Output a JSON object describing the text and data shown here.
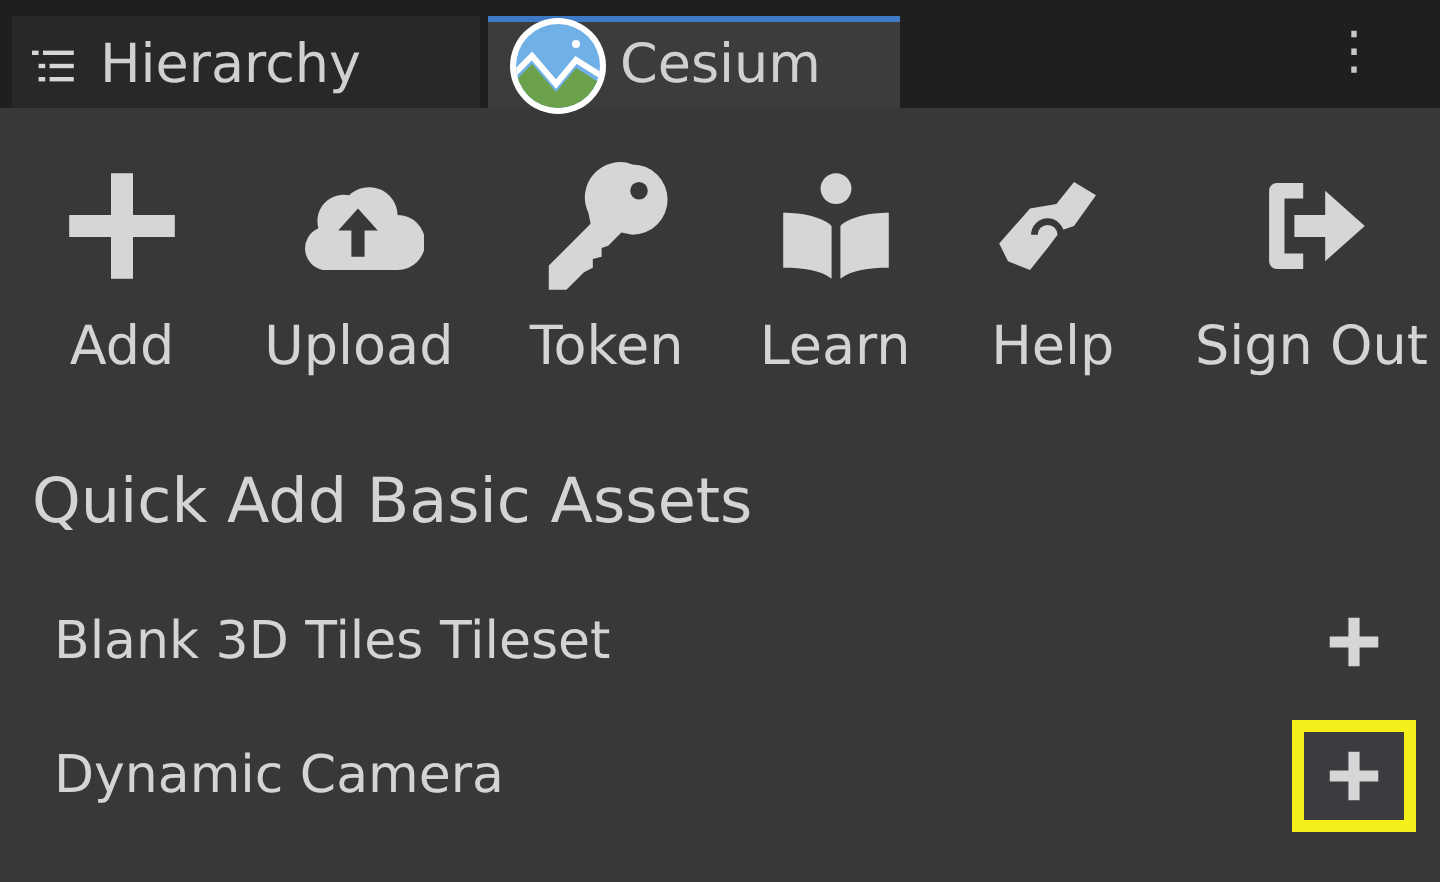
{
  "tabs": [
    {
      "label": "Hierarchy",
      "kind": "hierarchy",
      "selected": false
    },
    {
      "label": "Cesium",
      "kind": "cesium",
      "selected": true
    }
  ],
  "more_menu": "⋮",
  "toolbar": [
    {
      "label": "Add",
      "kind": "add"
    },
    {
      "label": "Upload",
      "kind": "upload"
    },
    {
      "label": "Token",
      "kind": "token"
    },
    {
      "label": "Learn",
      "kind": "learn"
    },
    {
      "label": "Help",
      "kind": "help"
    },
    {
      "label": "Sign Out",
      "kind": "signout"
    }
  ],
  "section_title": "Quick Add Basic Assets",
  "assets": [
    {
      "name": "Blank 3D Tiles Tileset",
      "highlighted": false
    },
    {
      "name": "Dynamic Camera",
      "highlighted": true
    }
  ]
}
